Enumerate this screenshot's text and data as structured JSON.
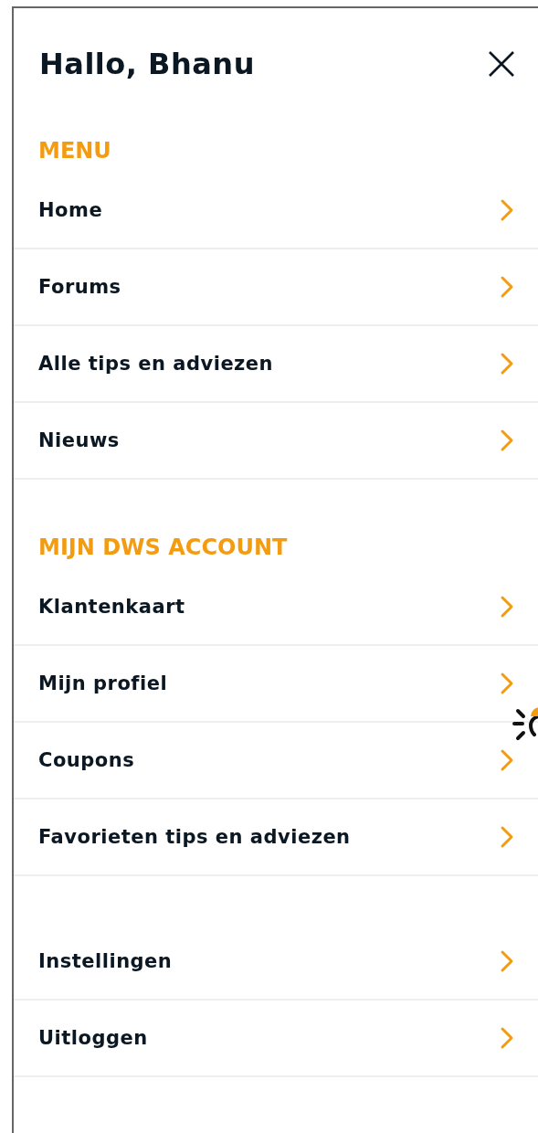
{
  "drawer": {
    "greeting": "Hallo, Bhanu",
    "sections": [
      {
        "title": "MENU",
        "items": [
          {
            "label": "Home"
          },
          {
            "label": "Forums"
          },
          {
            "label": "Alle tips en adviezen"
          },
          {
            "label": "Nieuws"
          }
        ]
      },
      {
        "title": "MIJN DWS ACCOUNT",
        "items": [
          {
            "label": "Klantenkaart"
          },
          {
            "label": "Mijn profiel"
          },
          {
            "label": "Coupons"
          },
          {
            "label": "Favorieten tips en adviezen"
          }
        ]
      },
      {
        "items": [
          {
            "label": "Instellingen"
          },
          {
            "label": "Uitloggen"
          }
        ]
      }
    ]
  }
}
